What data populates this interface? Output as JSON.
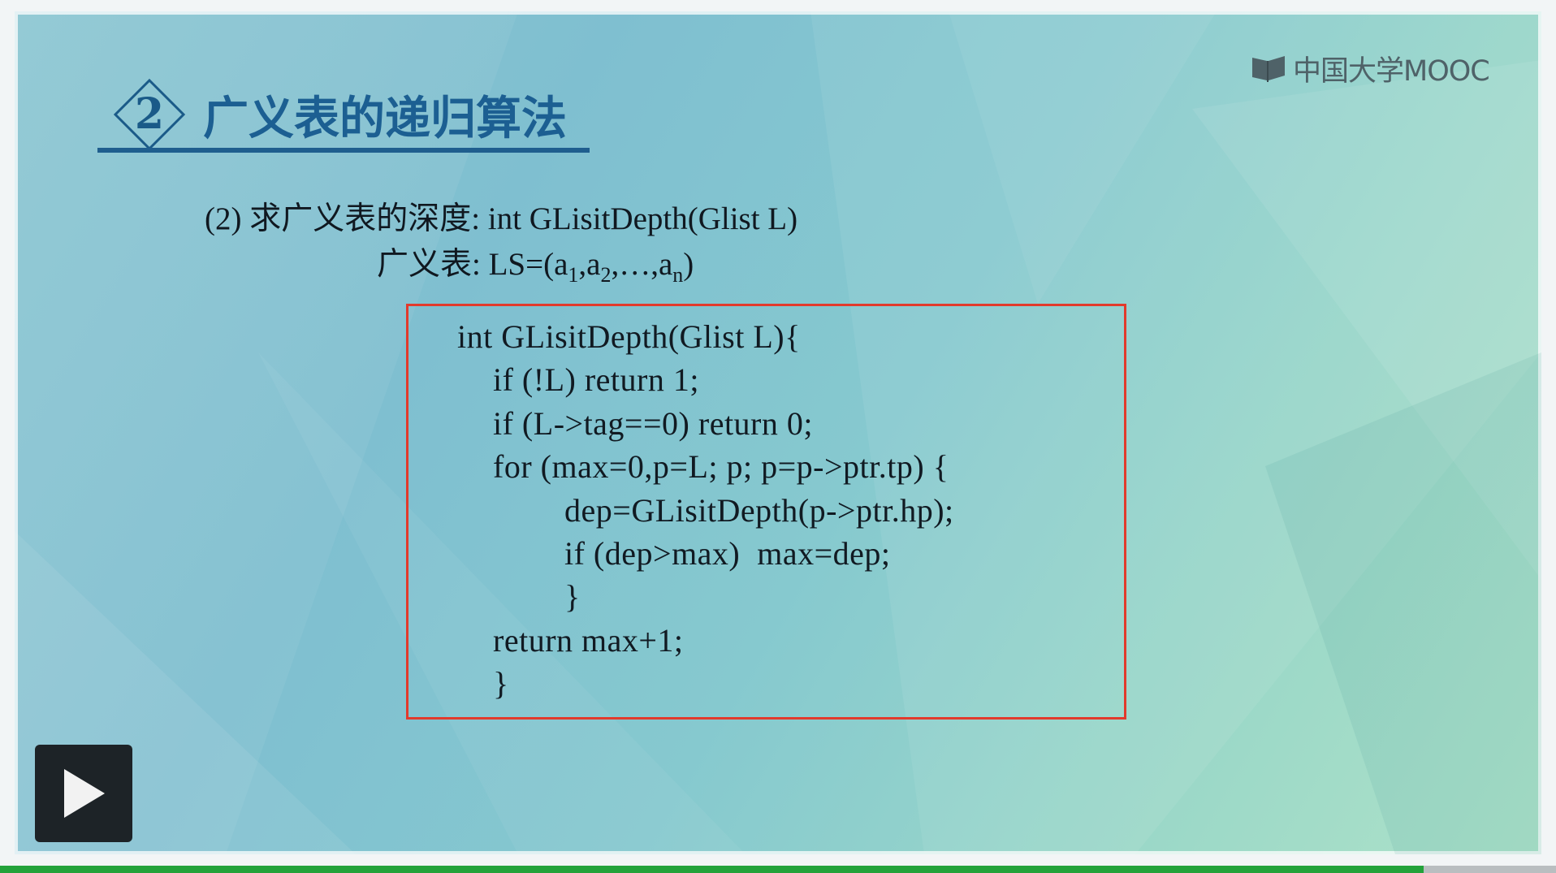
{
  "logo": {
    "text": "中国大学MOOC",
    "icon": "book-icon"
  },
  "section": {
    "number": "2",
    "title": "广义表的递归算法"
  },
  "description": {
    "line1": "(2) 求广义表的深度:  int GLisitDepth(Glist L)",
    "line2_prefix": "广义表: LS=(a",
    "line2_sub1": "1",
    "line2_mid1": ",a",
    "line2_sub2": "2",
    "line2_mid2": ",…,a",
    "line2_sub3": "n",
    "line2_suffix": ")"
  },
  "code": {
    "lines": [
      "int GLisitDepth(Glist L){",
      "if (!L) return 1;",
      "if (L->tag==0) return 0;",
      "for (max=0,p=L; p; p=p->ptr.tp) {",
      "dep=GLisitDepth(p->ptr.hp);",
      "if (dep>max)  max=dep;",
      "}",
      "return max+1;",
      "}"
    ]
  },
  "player": {
    "play_icon": "play-icon",
    "progress_fraction": 0.915
  },
  "colors": {
    "title": "#1c5f92",
    "code_border": "#e23a2c",
    "progress": "#23a23a"
  }
}
